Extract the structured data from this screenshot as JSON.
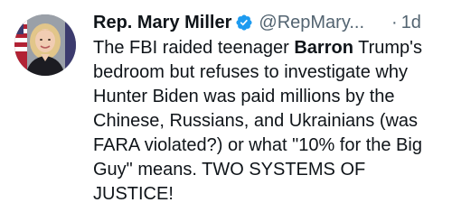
{
  "tweet": {
    "author_name": "Rep. Mary Miller",
    "verified_icon": "verified-badge-icon",
    "handle": "@RepMary...",
    "separator": "·",
    "timestamp": "1d",
    "text_part1": "The FBI raided teenager ",
    "text_bold": "Barron",
    "text_part2": " Trump's bedroom but refuses to investigate why Hunter Biden was paid millions by the Chinese, Russians, and Ukrainians (was FARA violated?) or what \"10% for the Big Guy\" means. TWO SYSTEMS OF JUSTICE!"
  },
  "colors": {
    "verified": "#1d9bf0",
    "secondary_text": "#536471",
    "primary_text": "#0f1419"
  }
}
